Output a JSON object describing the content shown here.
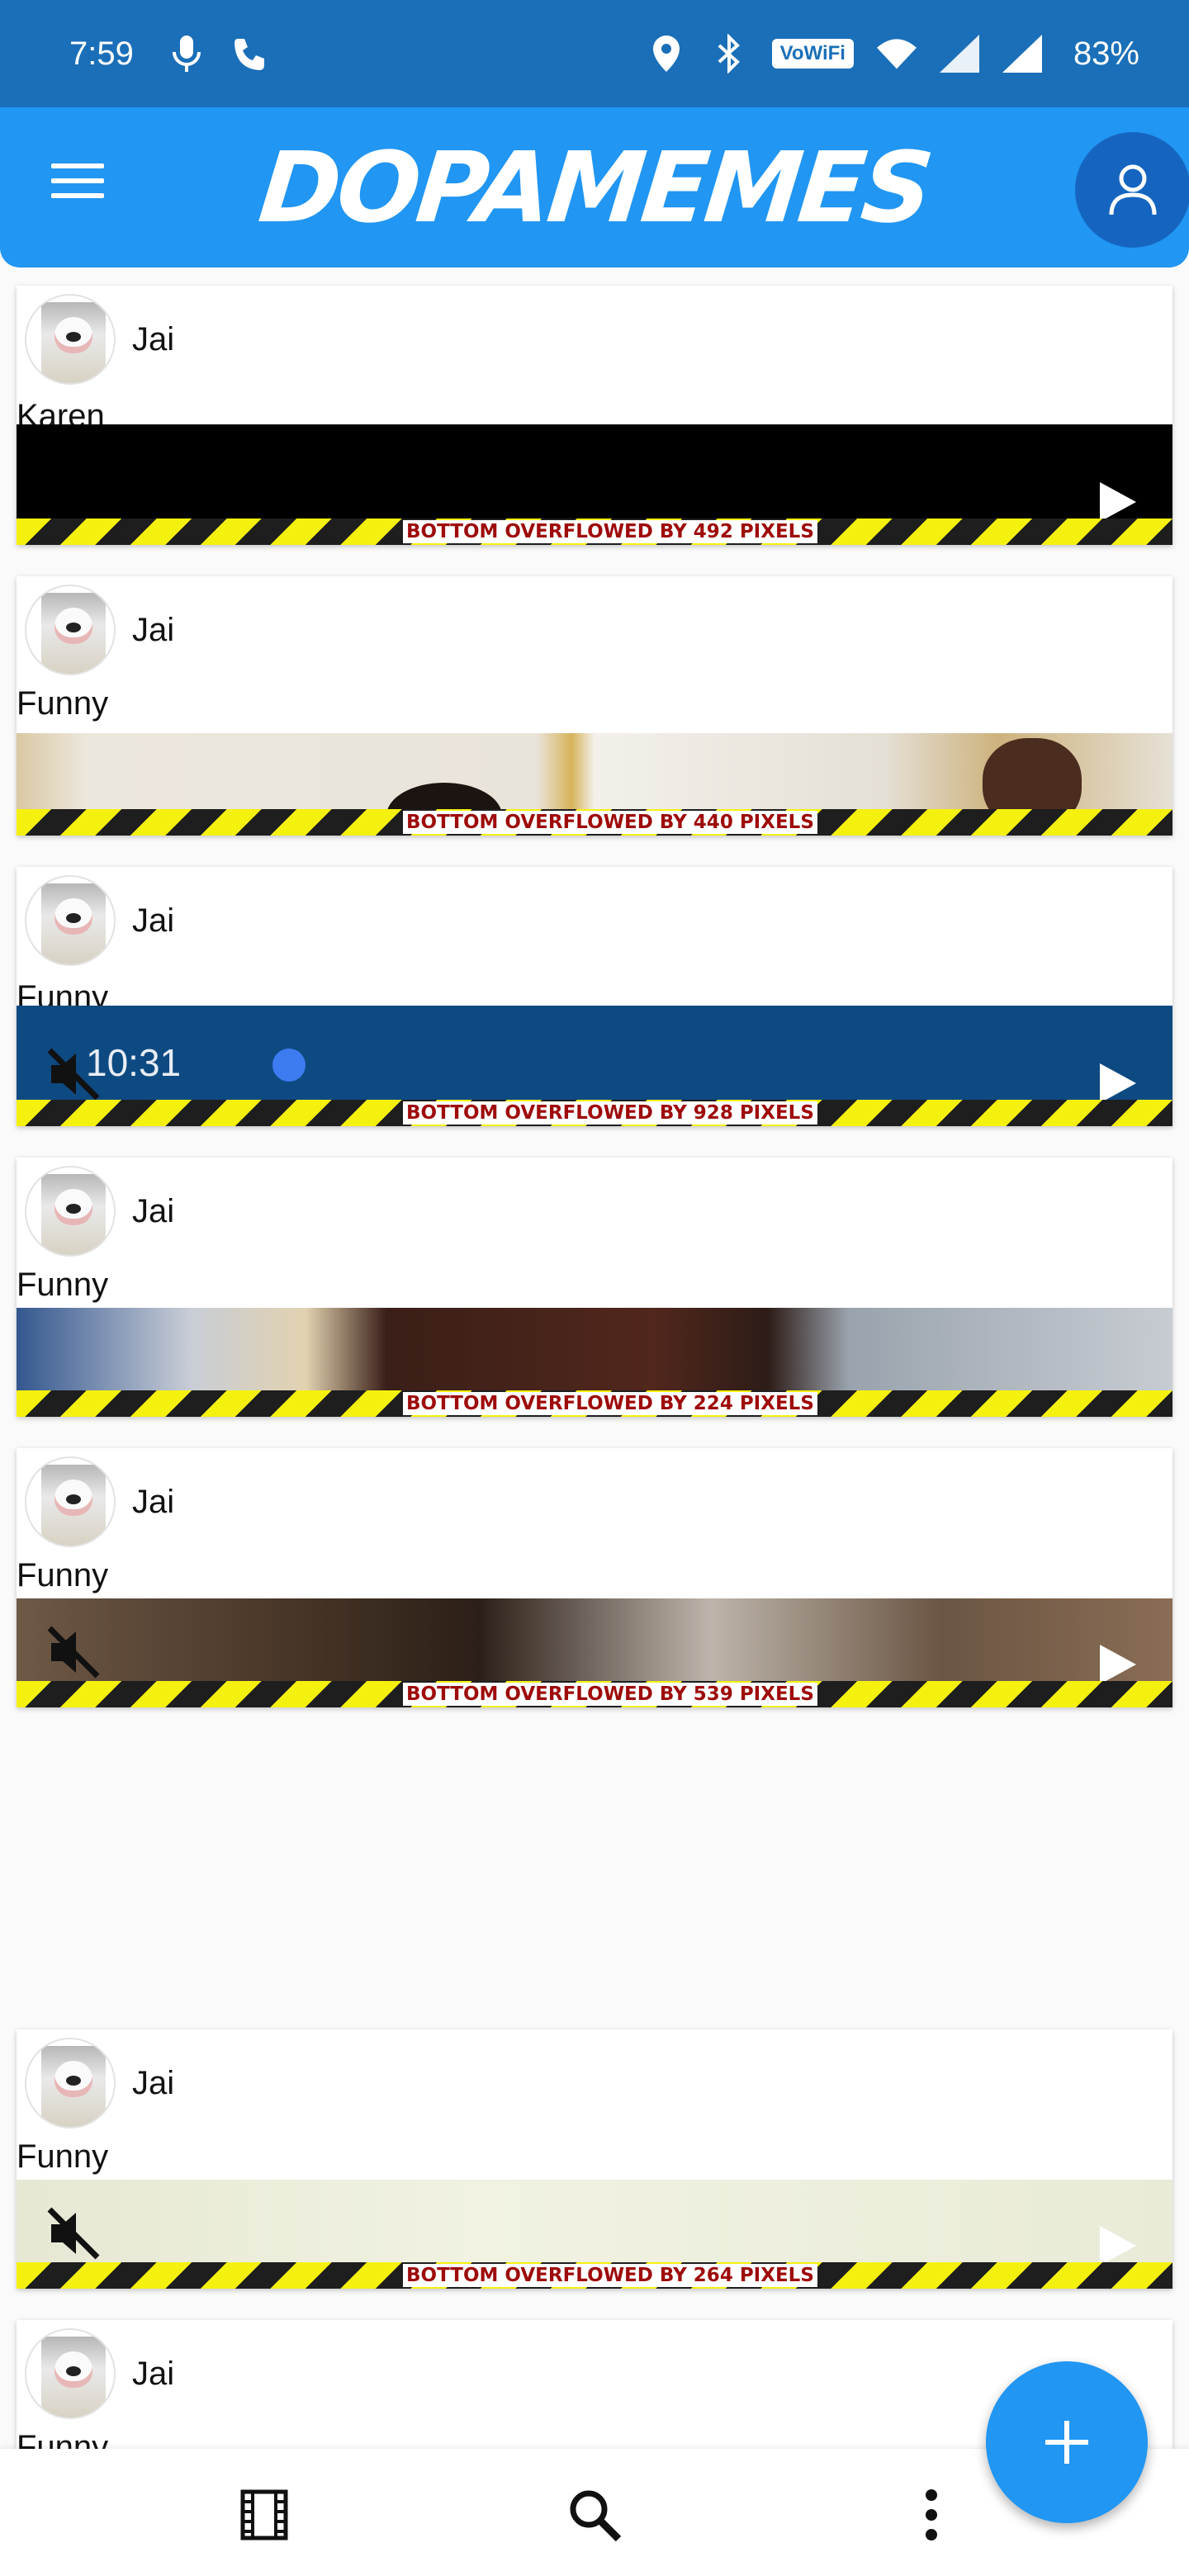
{
  "status_bar": {
    "time": "7:59",
    "wifi_badge": "VoWiFi",
    "battery": "83%"
  },
  "app_bar": {
    "title": "DOPAMEMES",
    "accent": "#2196f3"
  },
  "posts": [
    {
      "username": "Jai",
      "caption": "Karen",
      "overflow_text": "BOTTOM OVERFLOWED BY 492 PIXELS"
    },
    {
      "username": "Jai",
      "caption": "Funny",
      "overflow_text": "BOTTOM OVERFLOWED BY 440 PIXELS"
    },
    {
      "username": "Jai",
      "caption": "Funny",
      "overflow_text": "BOTTOM OVERFLOWED BY 928 PIXELS",
      "embedded_time": "10:31"
    },
    {
      "username": "Jai",
      "caption": "Funny",
      "overflow_text": "BOTTOM OVERFLOWED BY 224 PIXELS"
    },
    {
      "username": "Jai",
      "caption": "Funny",
      "overflow_text": "BOTTOM OVERFLOWED BY 539 PIXELS"
    },
    {
      "username": "Jai",
      "caption": "Funny",
      "overflow_text": "BOTTOM OVERFLOWED BY 264 PIXELS"
    },
    {
      "username": "Jai",
      "caption": "Funny"
    }
  ],
  "icons": {
    "menu": "hamburger-menu-icon",
    "profile": "person-icon",
    "mute": "volume-off-icon",
    "play": "play-icon",
    "nav_feed": "film-icon",
    "nav_search": "search-icon",
    "nav_more": "more-vert-icon",
    "fab": "add-icon"
  }
}
